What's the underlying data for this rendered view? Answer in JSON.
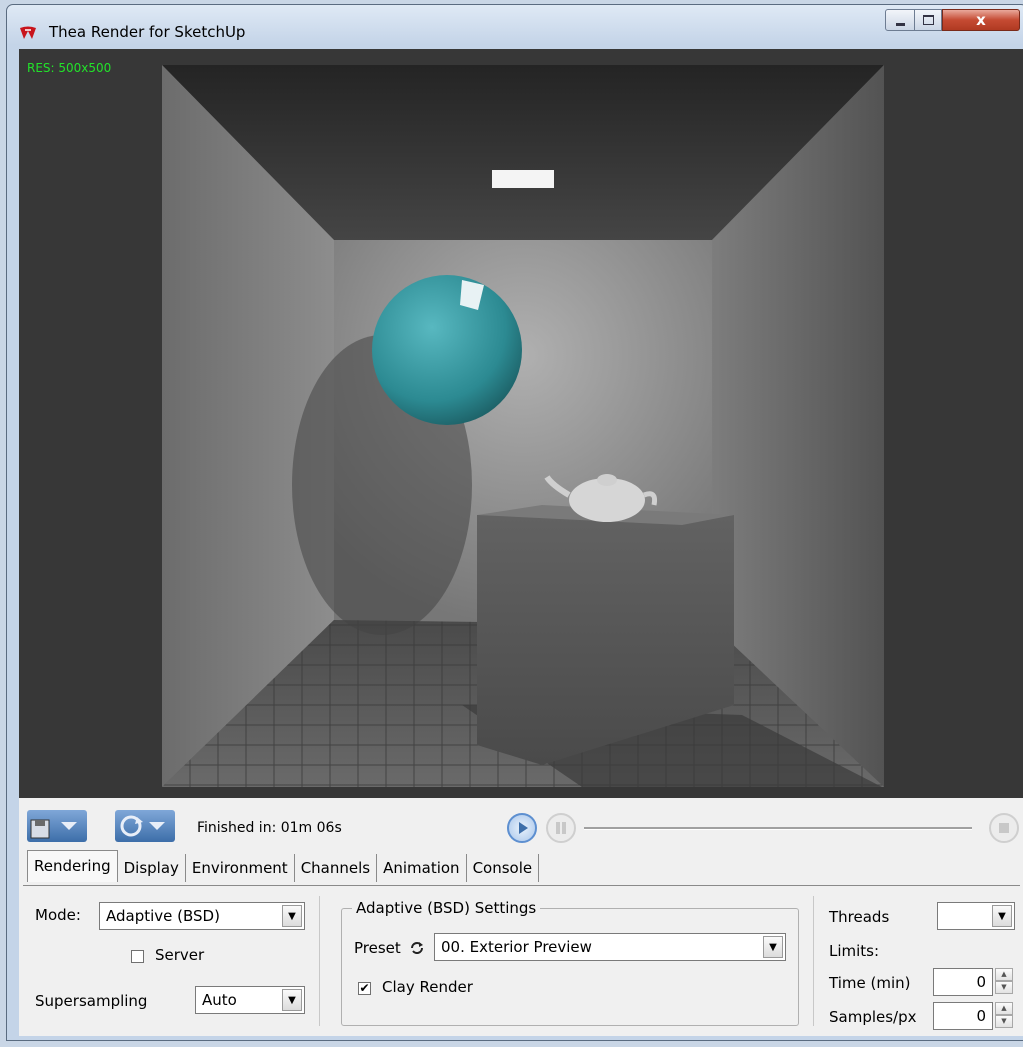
{
  "window": {
    "title": "Thea Render for SketchUp",
    "close_glyph": "x"
  },
  "viewport": {
    "resolution_label": "RES: 500x500"
  },
  "toolbar": {
    "status": "Finished in: 01m 06s",
    "progress": 0
  },
  "tabs": [
    {
      "label": "Rendering",
      "active": true
    },
    {
      "label": "Display"
    },
    {
      "label": "Environment"
    },
    {
      "label": "Channels"
    },
    {
      "label": "Animation"
    },
    {
      "label": "Console"
    }
  ],
  "rendering": {
    "mode_label": "Mode:",
    "mode_value": "Adaptive (BSD)",
    "server_label": "Server",
    "server_checked": false,
    "supersampling_label": "Supersampling",
    "supersampling_value": "Auto",
    "group_title": "Adaptive (BSD) Settings",
    "preset_label": "Preset",
    "preset_value": "00. Exterior Preview",
    "clay_label": "Clay Render",
    "clay_checked": true,
    "clay_check_glyph": "✔",
    "threads_label": "Threads",
    "threads_value": "",
    "limits_label": "Limits:",
    "time_label": "Time (min)",
    "time_value": "0",
    "samples_label": "Samples/px",
    "samples_value": "0"
  },
  "colors": {
    "res_text": "#22e22a",
    "accent": "#3d6ea9"
  }
}
